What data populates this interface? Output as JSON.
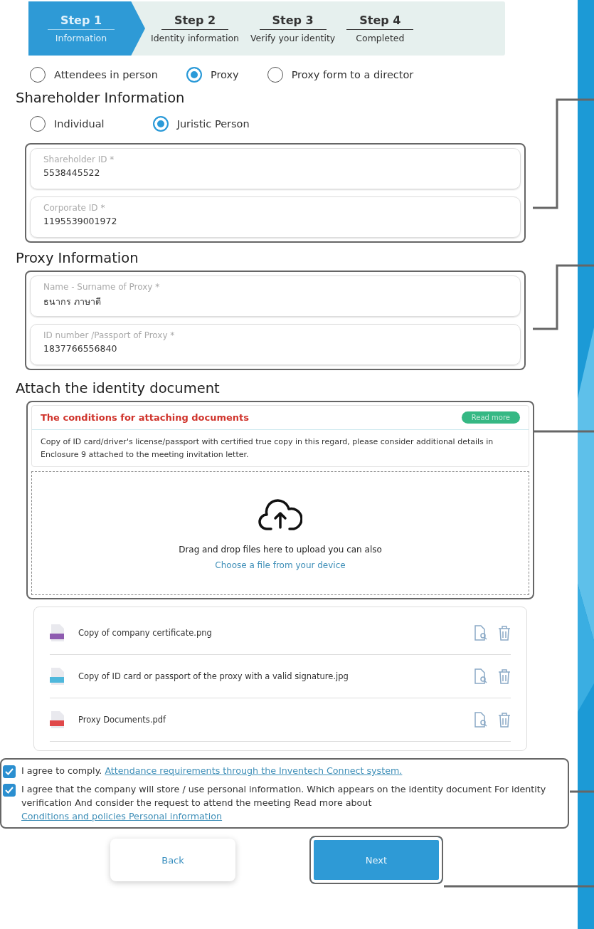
{
  "stepper": [
    {
      "title": "Step 1",
      "subtitle": "Information",
      "selected": true
    },
    {
      "title": "Step 2",
      "subtitle": "Identity information",
      "selected": false
    },
    {
      "title": "Step 3",
      "subtitle": "Verify your identity",
      "selected": false
    },
    {
      "title": "Step 4",
      "subtitle": "Completed",
      "selected": false
    }
  ],
  "attendance_type": [
    {
      "label": "Attendees in person",
      "selected": false
    },
    {
      "label": "Proxy",
      "selected": true
    },
    {
      "label": "Proxy form to a director",
      "selected": false
    }
  ],
  "shareholder_section": {
    "heading": "Shareholder Information",
    "types": [
      {
        "label": "Individual",
        "selected": false
      },
      {
        "label": "Juristic Person",
        "selected": true
      }
    ],
    "fields": [
      {
        "label": "Shareholder ID *",
        "value": "5538445522"
      },
      {
        "label": "Corporate ID *",
        "value": "1195539001972"
      }
    ]
  },
  "proxy_section": {
    "heading": "Proxy Information",
    "fields": [
      {
        "label": "Name - Surname of Proxy *",
        "value": "ธนากร ภาษาดี"
      },
      {
        "label": "ID number /Passport of Proxy *",
        "value": "1837766556840"
      }
    ]
  },
  "attachment_section": {
    "heading": "Attach the identity document",
    "conditions": {
      "title": "The conditions for attaching documents",
      "badge": "Read more",
      "text": "Copy of ID card/driver's license/passport with certified true copy in this regard, please consider additional details in Enclosure 9 attached to the meeting invitation letter."
    },
    "dropzone": {
      "text": "Drag and drop files here to upload you can also",
      "link": "Choose a file from your device"
    },
    "files": [
      {
        "name": "Copy of company certificate.png",
        "color": "#8e5bb0"
      },
      {
        "name": "Copy of ID card or passport of the proxy with a valid signature.jpg",
        "color": "#4fb8dc"
      },
      {
        "name": "Proxy Documents.pdf",
        "color": "#e0484a"
      }
    ]
  },
  "agreements": [
    {
      "checked": true,
      "text": "I agree to comply. ",
      "link": "Attendance requirements through the Inventech Connect system."
    },
    {
      "checked": true,
      "text": "I agree that the company will store / use personal information. Which appears on the identity document For identity verification And consider the request to attend the meeting Read more about ",
      "link": "Conditions and policies Personal information"
    }
  ],
  "buttons": [
    {
      "label": "Back",
      "kind": "secondary"
    },
    {
      "label": "Next",
      "kind": "primary"
    }
  ]
}
